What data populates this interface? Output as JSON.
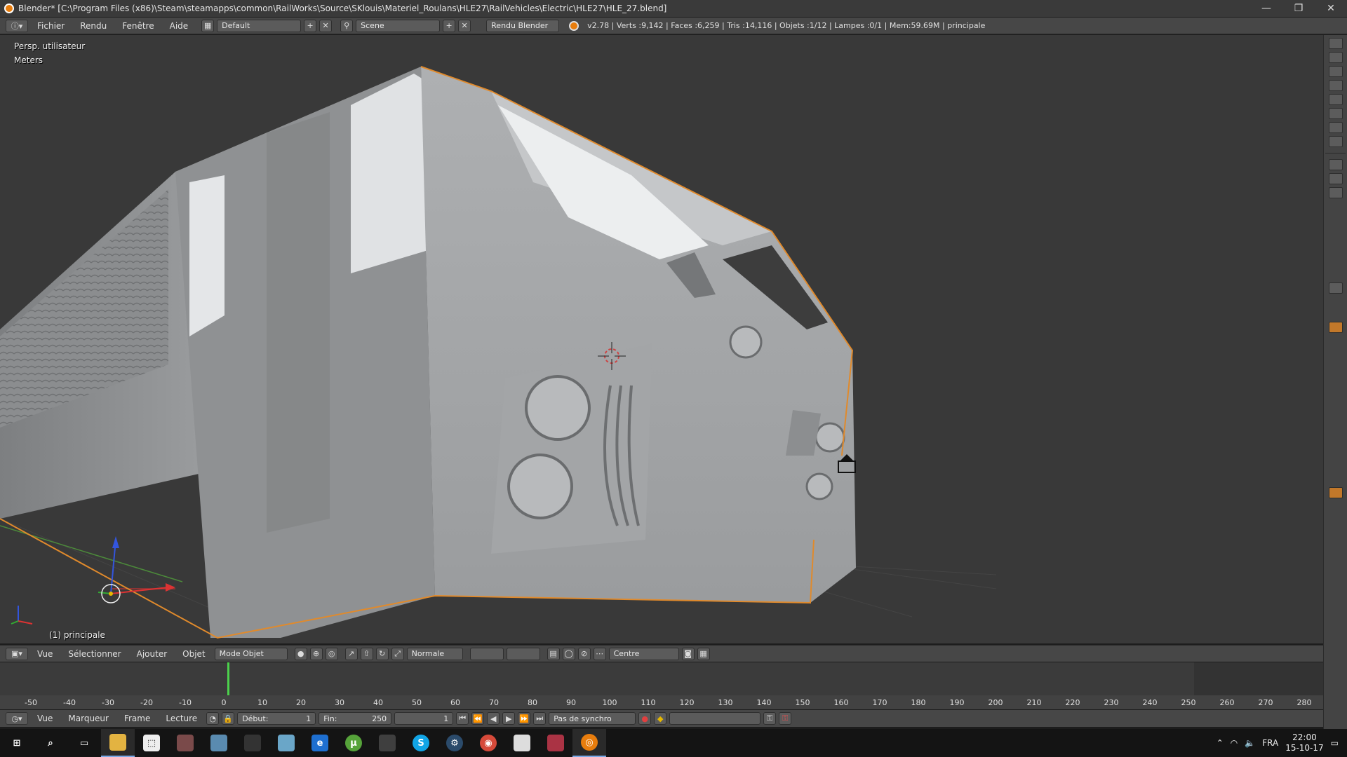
{
  "window": {
    "title": "Blender* [C:\\Program Files (x86)\\Steam\\steamapps\\common\\RailWorks\\Source\\SKlouis\\Materiel_Roulans\\HLE27\\RailVehicles\\Electric\\HLE27\\HLE_27.blend]",
    "minimize": "—",
    "restore": "❐",
    "close": "✕"
  },
  "infobar": {
    "menus": [
      "Fichier",
      "Rendu",
      "Fenêtre",
      "Aide"
    ],
    "layout": "Default",
    "scene": "Scene",
    "engine": "Rendu Blender",
    "stats": "v2.78 | Verts :9,142 | Faces :6,259 | Tris :14,116 | Objets :1/12 | Lampes :0/1 | Mem:59.69M | principale"
  },
  "viewport": {
    "view_name": "Persp. utilisateur",
    "units": "Meters",
    "object_label": "(1) principale"
  },
  "view3d_header": {
    "menus": [
      "Vue",
      "Sélectionner",
      "Ajouter",
      "Objet"
    ],
    "mode": "Mode Objet",
    "orientation": "Normale",
    "pivot": "Centre"
  },
  "timeline": {
    "ticks": [
      "-50",
      "-40",
      "-30",
      "-20",
      "-10",
      "0",
      "10",
      "20",
      "30",
      "40",
      "50",
      "60",
      "70",
      "80",
      "90",
      "100",
      "110",
      "120",
      "130",
      "140",
      "150",
      "160",
      "170",
      "180",
      "190",
      "200",
      "210",
      "220",
      "230",
      "240",
      "250",
      "260",
      "270",
      "280"
    ],
    "menus": [
      "Vue",
      "Marqueur",
      "Frame",
      "Lecture"
    ],
    "start_label": "Début:",
    "start_value": "1",
    "end_label": "Fin:",
    "end_value": "250",
    "current_frame": "1",
    "sync": "Pas de synchro"
  },
  "taskbar": {
    "language": "FRA",
    "time": "22:00",
    "date": "15-10-17"
  }
}
